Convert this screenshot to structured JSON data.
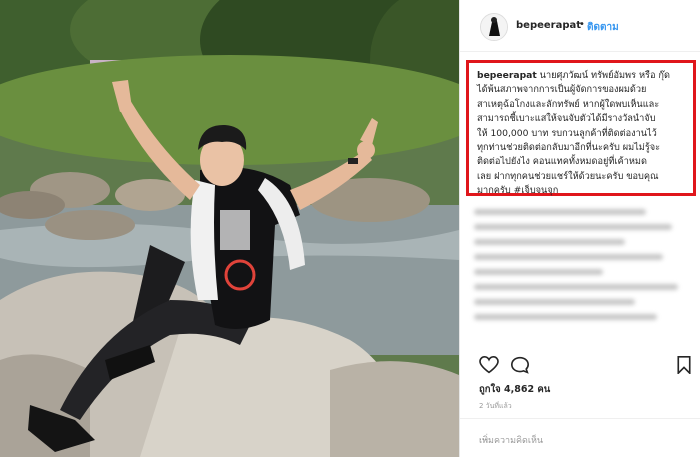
{
  "post": {
    "username": "bepeerapat",
    "separator": "•",
    "follow_label": "ติดตาม",
    "caption_user": "bepeerapat",
    "caption_lines": [
      "นายศุภวัฒน์ ทรัพย์อัมพร หรือ กุ๊ด",
      "ได้พ้นสภาพจากการเป็นผู้จัดการของผมด้วย",
      "สาเหตุฉ้อโกงและลักทรัพย์ หากผู้ใดพบเห็นและ",
      "สามารถชี้เบาะแสให้จนจับตัวได้มีรางวัลนำจับ",
      "ให้ 100,000 บาท รบกวนลูกค้าที่ติดต่องานไว้",
      "ทุกท่านช่วยติดต่อกลับมาอีกที่นะครับ ผมไม่รู้จะ",
      "ติดต่อไปยังไง คอนแทคทั้งหมดอยู่ที่เค้าหมด",
      "เลย ฝากทุกคนช่วยแชร์ให้ด้วยนะครับ ขอบคุณ",
      "มากครับ #เจ็บจนจุก"
    ],
    "likes": "ถูกใจ 4,862 คน",
    "time": "2 วันที่แล้ว",
    "add_comment_placeholder": "เพิ่มความคิดเห็น",
    "more": "..."
  },
  "icons": {
    "heart": "heart-icon",
    "comment": "comment-icon",
    "save": "bookmark-icon"
  },
  "colors": {
    "follow": "#3897f0",
    "highlight_border": "#e0161b",
    "text": "#262626"
  }
}
